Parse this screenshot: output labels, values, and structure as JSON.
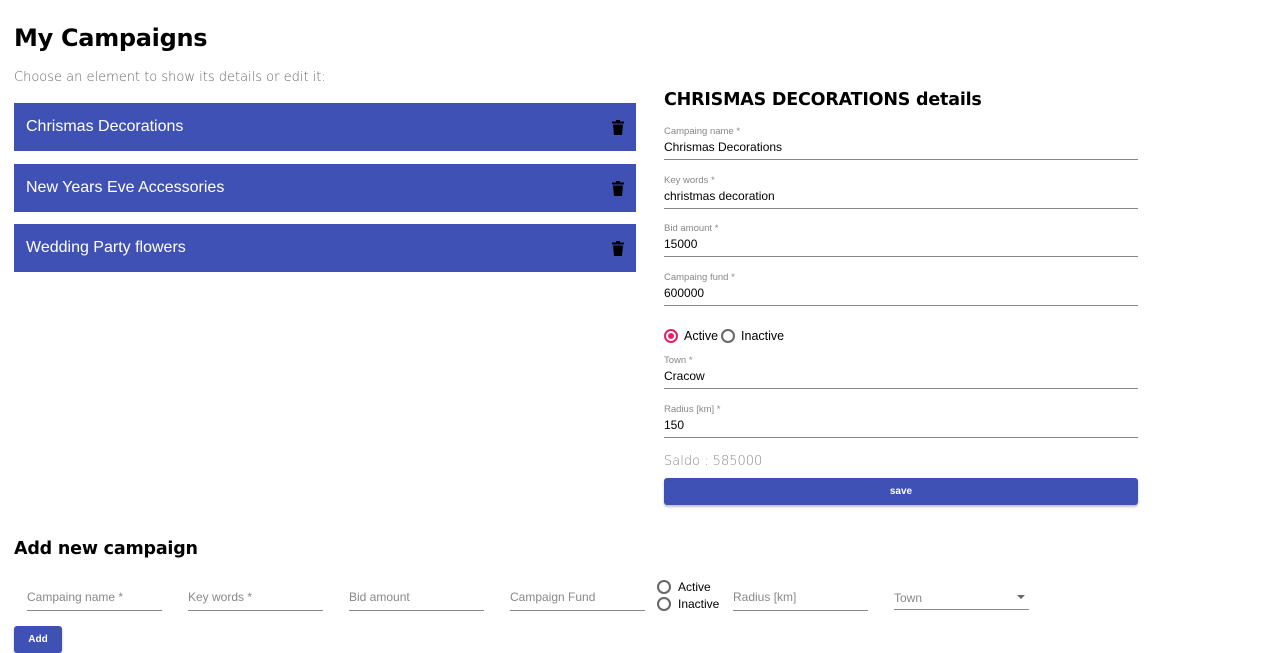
{
  "page": {
    "title": "My Campaigns",
    "subtitle": "Choose an element to show its details or edit it:"
  },
  "campaigns": [
    {
      "name": "Chrismas Decorations",
      "icon": "trash-icon"
    },
    {
      "name": "New Years Eve Accessories",
      "icon": "trash-icon"
    },
    {
      "name": "Wedding Party flowers",
      "icon": "trash-icon"
    }
  ],
  "details": {
    "heading": "CHRISMAS DECORATIONS details",
    "fields": {
      "campaign_name": {
        "label": "Campaing name *",
        "value": "Chrismas Decorations"
      },
      "key_words": {
        "label": "Key words *",
        "value": "christmas decoration"
      },
      "bid_amount": {
        "label": "Bid amount *",
        "value": "15000"
      },
      "campaign_fund": {
        "label": "Campaing fund *",
        "value": "600000"
      },
      "town": {
        "label": "Town *",
        "value": "Cracow"
      },
      "radius": {
        "label": "Radius [km] *",
        "value": "150"
      }
    },
    "status": {
      "active_label": "Active",
      "inactive_label": "Inactive",
      "selected": "Active"
    },
    "saldo": "Saldo : 585000",
    "save_label": "save"
  },
  "add": {
    "heading": "Add new campaign",
    "placeholders": {
      "campaign_name": "Campaing name *",
      "key_words": "Key words *",
      "bid_amount": "Bid amount",
      "campaign_fund": "Campaign Fund",
      "radius": "Radius [km]"
    },
    "active_label": "Active",
    "inactive_label": "Inactive",
    "town_placeholder": "Town",
    "add_label": "Add"
  },
  "colors": {
    "primary": "#3f51b5",
    "radio_accent": "#e91e63"
  }
}
